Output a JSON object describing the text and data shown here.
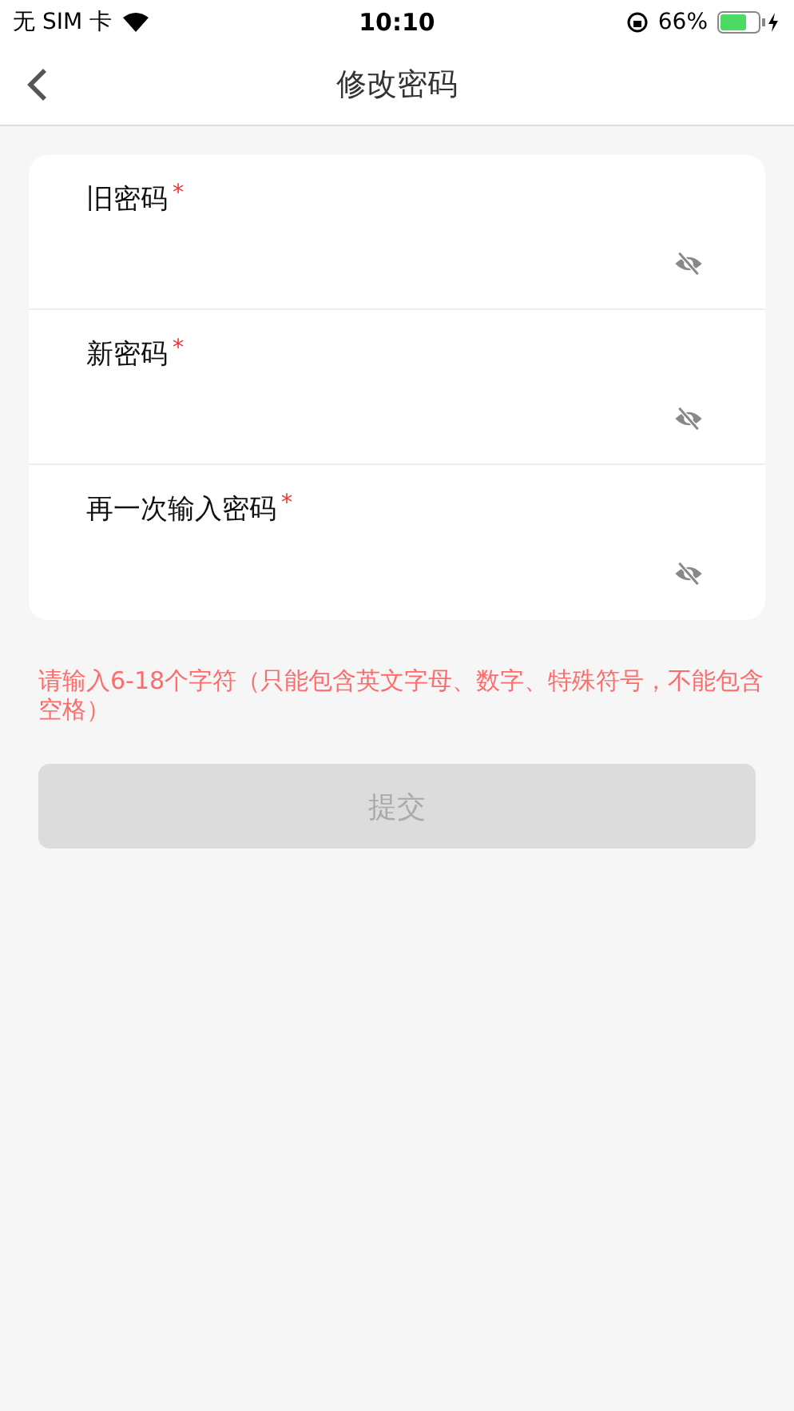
{
  "status_bar": {
    "carrier": "无 SIM 卡",
    "time": "10:10",
    "battery": "66%"
  },
  "nav_bar": {
    "title": "修改密码"
  },
  "fields": [
    {
      "label": "旧密码",
      "marker": "*",
      "required": true,
      "visible": false
    },
    {
      "label": "新密码",
      "marker": "*",
      "required": true,
      "visible": false
    },
    {
      "label": "再一次输入密码",
      "marker": "*",
      "required": true,
      "visible": false
    }
  ],
  "hint": "请输入6-18个字符（只能包含英文字母、数字、特殊符号，不能包含空格）",
  "submit_button": {
    "label": "提交",
    "disabled": true
  }
}
